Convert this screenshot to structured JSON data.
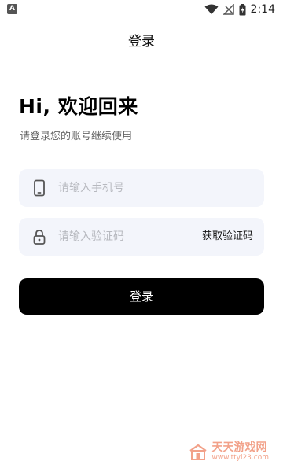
{
  "status_bar": {
    "notification_icon_letter": "A",
    "time": "2:14"
  },
  "nav": {
    "title": "登录"
  },
  "greeting": {
    "title": "Hi, 欢迎回来",
    "subtitle": "请登录您的账号继续使用"
  },
  "form": {
    "phone": {
      "placeholder": "请输入手机号",
      "value": "",
      "icon": "phone-icon"
    },
    "code": {
      "placeholder": "请输入验证码",
      "value": "",
      "icon": "lock-icon",
      "get_code_label": "获取验证码"
    },
    "submit_label": "登录"
  },
  "watermark": {
    "main": "天天游戏网",
    "sub": "www.ttyl23.com"
  },
  "colors": {
    "button": "#000000",
    "field_bg": "#f3f5fb",
    "watermark": "#e8562a"
  }
}
